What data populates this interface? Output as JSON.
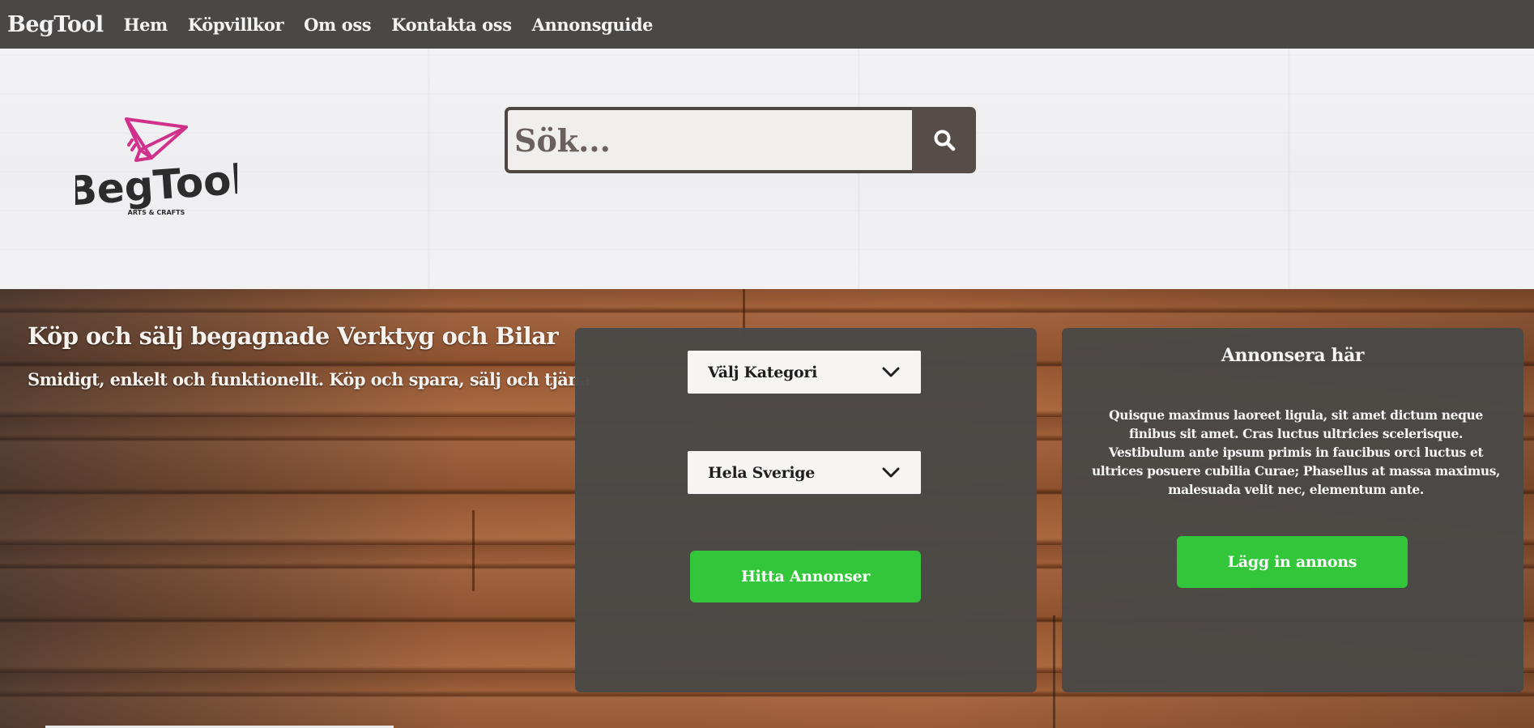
{
  "nav": {
    "brand": "BegTool",
    "links": [
      "Hem",
      "Köpvillkor",
      "Om oss",
      "Kontakta oss",
      "Annonsguide"
    ]
  },
  "logo": {
    "name": "BegTool",
    "tagline": "ARTS & CRAFTS",
    "accent_color": "#d0318b"
  },
  "search": {
    "placeholder": "Sök...",
    "icon": "search-icon"
  },
  "hero": {
    "title": "Köp och sälj begagnade Verktyg och Bilar",
    "subtitle": "Smidigt, enkelt och funktionellt. Köp och spara, sälj och tjäna"
  },
  "filter_panel": {
    "category_select": "Välj Kategori",
    "region_select": "Hela Sverige",
    "find_button": "Hitta Annonser"
  },
  "ad_panel": {
    "title": "Annonsera här",
    "body": "Quisque maximus laoreet ligula, sit amet dictum neque finibus sit amet. Cras luctus ultricies scelerisque. Vestibulum ante ipsum primis in faucibus orci luctus et ultrices posuere cubilia Curae; Phasellus at massa maximus, malesuada velit nec, elementum ante.",
    "button": "Lägg in annons"
  },
  "colors": {
    "nav_bg": "#4a4846",
    "panel_bg": "#4a4846",
    "button_green": "#34c63a",
    "search_button": "#564c48"
  }
}
